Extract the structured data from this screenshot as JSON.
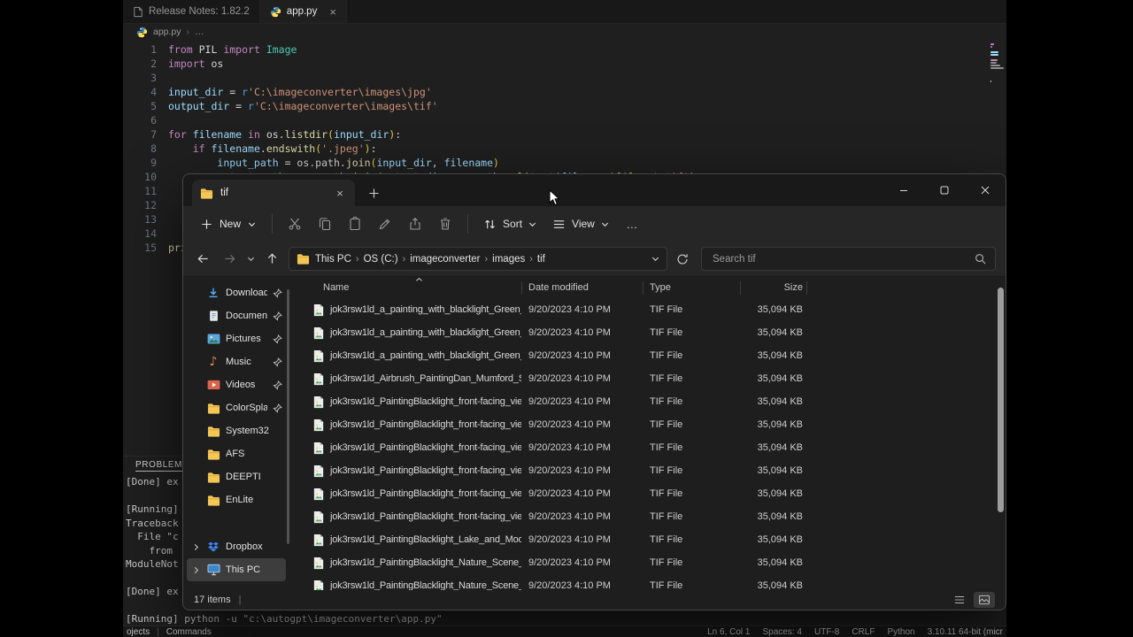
{
  "vscode": {
    "tabs": [
      {
        "label": "Release Notes: 1.82.2",
        "icon": "doc",
        "active": false,
        "closable": false
      },
      {
        "label": "app.py",
        "icon": "python",
        "active": true,
        "closable": true
      }
    ],
    "breadcrumb": {
      "file": "app.py",
      "sep": "›",
      "more": "…"
    },
    "code": [
      {
        "n": "1",
        "t": [
          [
            "k",
            "from"
          ],
          [
            "p",
            " PIL "
          ],
          [
            "k",
            "import"
          ],
          [
            "p",
            " "
          ],
          [
            "c",
            "Image"
          ]
        ]
      },
      {
        "n": "2",
        "t": [
          [
            "k",
            "import"
          ],
          [
            "p",
            " os"
          ]
        ]
      },
      {
        "n": "3",
        "t": []
      },
      {
        "n": "4",
        "t": [
          [
            "v",
            "input_dir"
          ],
          [
            "p",
            " = "
          ],
          [
            "r",
            "r"
          ],
          [
            "s",
            "'C:\\imageconverter\\images\\jpg'"
          ]
        ]
      },
      {
        "n": "5",
        "t": [
          [
            "v",
            "output_dir"
          ],
          [
            "p",
            " = "
          ],
          [
            "r",
            "r"
          ],
          [
            "s",
            "'C:\\imageconverter\\images\\tif'"
          ]
        ]
      },
      {
        "n": "6",
        "t": []
      },
      {
        "n": "7",
        "t": [
          [
            "k",
            "for"
          ],
          [
            "p",
            " "
          ],
          [
            "v",
            "filename"
          ],
          [
            "p",
            " "
          ],
          [
            "k",
            "in"
          ],
          [
            "p",
            " os."
          ],
          [
            "f",
            "listdir"
          ],
          [
            "b",
            "("
          ],
          [
            "v",
            "input_dir"
          ],
          [
            "b",
            ")"
          ],
          [
            "p",
            ":"
          ]
        ]
      },
      {
        "n": "8",
        "t": [
          [
            "p",
            "    "
          ],
          [
            "k",
            "if"
          ],
          [
            "p",
            " "
          ],
          [
            "v",
            "filename"
          ],
          [
            "p",
            "."
          ],
          [
            "f",
            "endswith"
          ],
          [
            "b",
            "("
          ],
          [
            "s",
            "'.jpeg'"
          ],
          [
            "b",
            ")"
          ],
          [
            "p",
            ":"
          ]
        ]
      },
      {
        "n": "9",
        "t": [
          [
            "p",
            "        "
          ],
          [
            "v",
            "input_path"
          ],
          [
            "p",
            " = os.path."
          ],
          [
            "f",
            "join"
          ],
          [
            "b",
            "("
          ],
          [
            "v",
            "input_dir"
          ],
          [
            "p",
            ", "
          ],
          [
            "v",
            "filename"
          ],
          [
            "b",
            ")"
          ]
        ]
      },
      {
        "n": "10",
        "t": [
          [
            "p",
            "        "
          ],
          [
            "v",
            "output_path"
          ],
          [
            "p",
            " = os.path."
          ],
          [
            "f",
            "join"
          ],
          [
            "b",
            "("
          ],
          [
            "v",
            "output_dir"
          ],
          [
            "p",
            ", os.path."
          ],
          [
            "f",
            "splitext"
          ],
          [
            "b",
            "("
          ],
          [
            "v",
            "filename"
          ],
          [
            "b",
            ")"
          ],
          [
            "b",
            "["
          ],
          [
            "n2",
            "0"
          ],
          [
            "b",
            "]"
          ],
          [
            "p",
            " + "
          ],
          [
            "s",
            "'.tif'"
          ],
          [
            "b",
            ")"
          ]
        ]
      },
      {
        "n": "11",
        "t": []
      },
      {
        "n": "12",
        "t": []
      },
      {
        "n": "13",
        "t": []
      },
      {
        "n": "14",
        "t": []
      },
      {
        "n": "15",
        "t": [
          [
            "f",
            "print"
          ]
        ]
      }
    ],
    "panel": {
      "tab": "PROBLEMS",
      "lines": [
        "[Done] ex",
        "",
        "[Running]",
        "Traceback",
        "  File \"c",
        "    from",
        "ModuleNot",
        "",
        "[Done] ex",
        "",
        "[Running] python -u \"c:\\autogpt\\imageconverter\\app.py\""
      ]
    },
    "status": {
      "left": [
        "ojects",
        "Commands"
      ],
      "divider": "|",
      "right": [
        "Ln 6, Col 1",
        "Spaces: 4",
        "UTF-8",
        "CRLF",
        "Python",
        "3.10.11 64-bit (micr"
      ]
    }
  },
  "explorer": {
    "tab": "tif",
    "toolbar": {
      "new_label": "New",
      "buttons": [
        "cut",
        "copy",
        "paste",
        "rename",
        "share",
        "delete"
      ],
      "sort_label": "Sort",
      "view_label": "View",
      "more": "…"
    },
    "nav": {
      "breadcrumb": [
        "This PC",
        "OS (C:)",
        "imageconverter",
        "images",
        "tif"
      ],
      "sep": "›",
      "search_placeholder": "Search tif"
    },
    "sidebar": [
      {
        "label": "Downloads",
        "icon": "download",
        "pinned": true
      },
      {
        "label": "Documents",
        "icon": "documents",
        "pinned": true
      },
      {
        "label": "Pictures",
        "icon": "pictures",
        "pinned": true
      },
      {
        "label": "Music",
        "icon": "music",
        "pinned": true
      },
      {
        "label": "Videos",
        "icon": "videos",
        "pinned": true
      },
      {
        "label": "ColorSplashPr",
        "icon": "folder",
        "pinned": true
      },
      {
        "label": "System32",
        "icon": "folder",
        "pinned": false
      },
      {
        "label": "AFS",
        "icon": "folder",
        "pinned": false
      },
      {
        "label": "DEEPTI",
        "icon": "folder",
        "pinned": false
      },
      {
        "label": "EnLite",
        "icon": "folder",
        "pinned": false
      },
      {
        "label": "Dropbox",
        "icon": "dropbox",
        "expandable": true,
        "section_gap": true
      },
      {
        "label": "This PC",
        "icon": "pc",
        "expandable": true,
        "selected": true
      }
    ],
    "columns": [
      "Name",
      "Date modified",
      "Type",
      "Size"
    ],
    "rows": [
      {
        "name": "jok3rsw1ld_a_painting_with_blacklight_Green_D...",
        "date": "9/20/2023 4:10 PM",
        "type": "TIF File",
        "size": "35,094 KB"
      },
      {
        "name": "jok3rsw1ld_a_painting_with_blacklight_Green_D...",
        "date": "9/20/2023 4:10 PM",
        "type": "TIF File",
        "size": "35,094 KB"
      },
      {
        "name": "jok3rsw1ld_a_painting_with_blacklight_Green_D...",
        "date": "9/20/2023 4:10 PM",
        "type": "TIF File",
        "size": "35,094 KB"
      },
      {
        "name": "jok3rsw1ld_Airbrush_PaintingDan_Mumford_Sty...",
        "date": "9/20/2023 4:10 PM",
        "type": "TIF File",
        "size": "35,094 KB"
      },
      {
        "name": "jok3rsw1ld_PaintingBlacklight_front-facing_vie...",
        "date": "9/20/2023 4:10 PM",
        "type": "TIF File",
        "size": "35,094 KB"
      },
      {
        "name": "jok3rsw1ld_PaintingBlacklight_front-facing_vie...",
        "date": "9/20/2023 4:10 PM",
        "type": "TIF File",
        "size": "35,094 KB"
      },
      {
        "name": "jok3rsw1ld_PaintingBlacklight_front-facing_vie...",
        "date": "9/20/2023 4:10 PM",
        "type": "TIF File",
        "size": "35,094 KB"
      },
      {
        "name": "jok3rsw1ld_PaintingBlacklight_front-facing_vie...",
        "date": "9/20/2023 4:10 PM",
        "type": "TIF File",
        "size": "35,094 KB"
      },
      {
        "name": "jok3rsw1ld_PaintingBlacklight_front-facing_vie...",
        "date": "9/20/2023 4:10 PM",
        "type": "TIF File",
        "size": "35,094 KB"
      },
      {
        "name": "jok3rsw1ld_PaintingBlacklight_front-facing_vie...",
        "date": "9/20/2023 4:10 PM",
        "type": "TIF File",
        "size": "35,094 KB"
      },
      {
        "name": "jok3rsw1ld_PaintingBlacklight_Lake_and_Moon_...",
        "date": "9/20/2023 4:10 PM",
        "type": "TIF File",
        "size": "35,094 KB"
      },
      {
        "name": "jok3rsw1ld_PaintingBlacklight_Nature_Scene_N...",
        "date": "9/20/2023 4:10 PM",
        "type": "TIF File",
        "size": "35,094 KB"
      },
      {
        "name": "jok3rsw1ld_PaintingBlacklight_Nature_Scene_N...",
        "date": "9/20/2023 4:10 PM",
        "type": "TIF File",
        "size": "35,094 KB"
      }
    ],
    "status_items": "17 items",
    "status_divider": "|"
  }
}
